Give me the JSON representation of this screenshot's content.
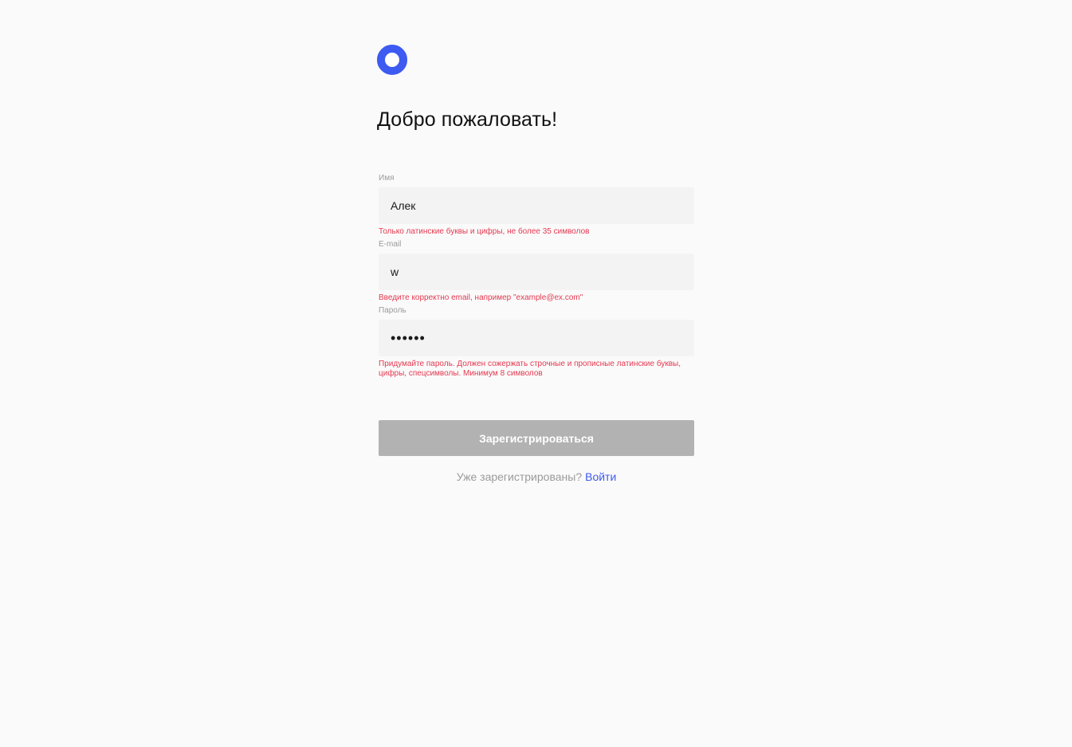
{
  "logo": {
    "icon": "ring-logo-icon",
    "color": "#3d5af1"
  },
  "title": "Добро пожаловать!",
  "form": {
    "name": {
      "label": "Имя",
      "value": "Алек",
      "error": "Только латинские буквы и цифры, не более 35 символов"
    },
    "email": {
      "label": "E-mail",
      "value": "w",
      "error": "Введите корректно email, например \"example@ex.com\""
    },
    "password": {
      "label": "Пароль",
      "value": "••••••",
      "error": "Придумайте пароль. Должен сожержать строчные и прописные латинские буквы, цифры, спецсимволы. Минимум 8 символов"
    },
    "submit_label": "Зарегистрироваться"
  },
  "login": {
    "prompt": "Уже зарегистрированы?",
    "link_label": "Войти"
  },
  "colors": {
    "accent": "#3d5af1",
    "error": "#e53950",
    "button_disabled": "#b2b2b2",
    "input_bg": "#f3f3f3",
    "page_bg": "#fafafa"
  }
}
